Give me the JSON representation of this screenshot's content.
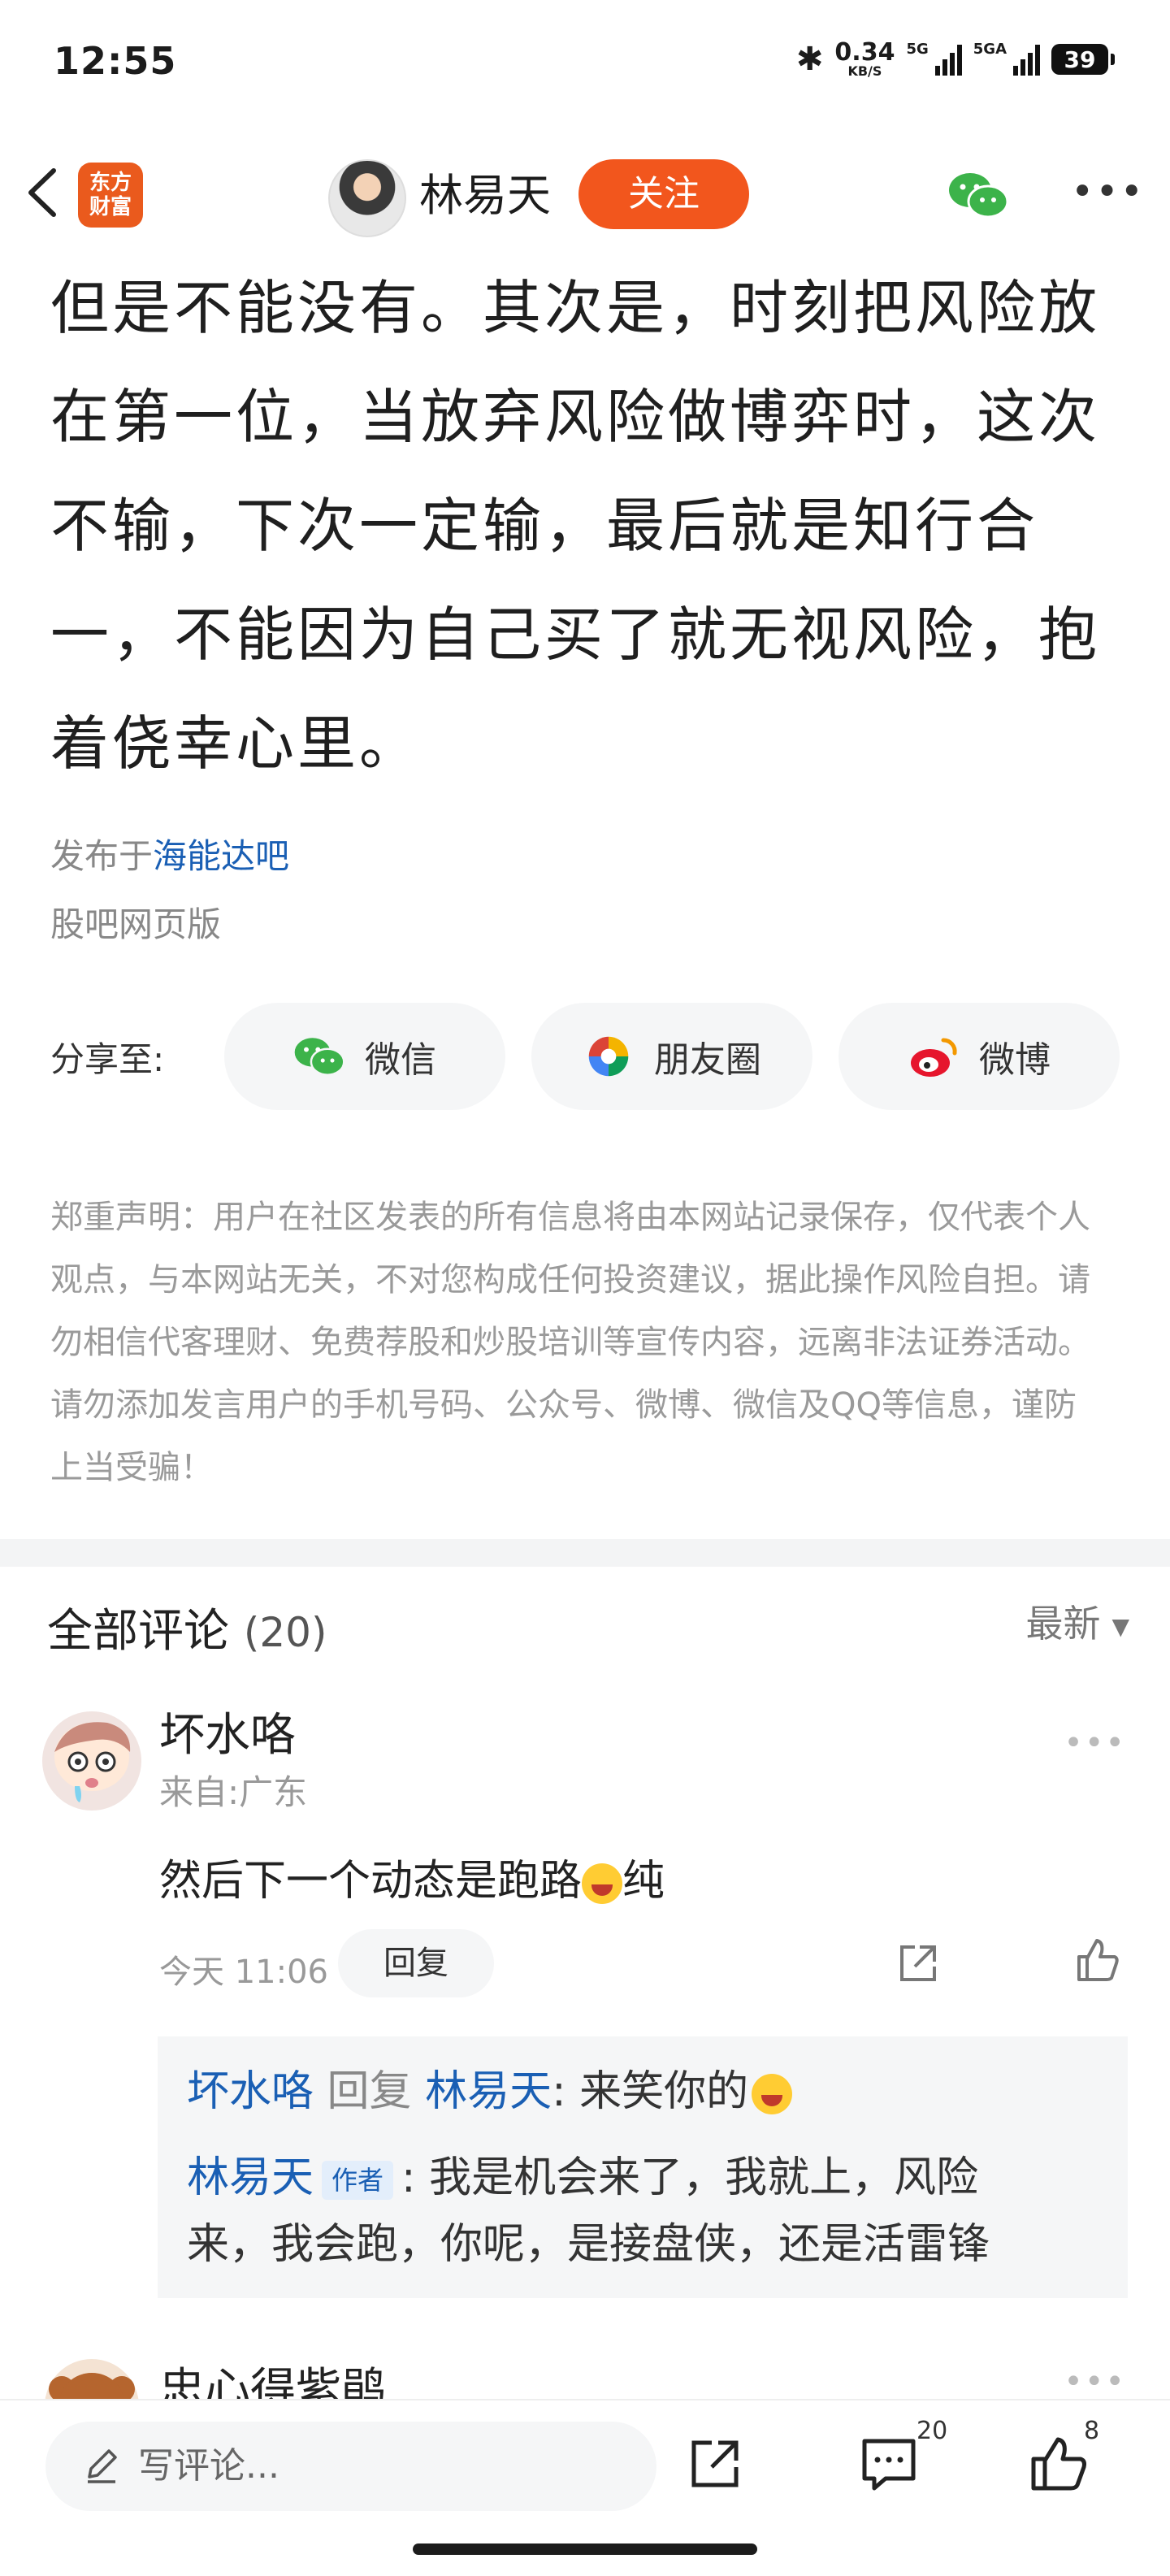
{
  "status_bar": {
    "time": "12:55",
    "speed_value": "0.34",
    "speed_unit": "KB/S",
    "net1": "5G",
    "net2": "5GA",
    "battery": "39"
  },
  "nav": {
    "logo_line1": "东方",
    "logo_line2": "财富",
    "author": "林易天",
    "follow": "关注"
  },
  "article": {
    "lines": [
      "但是不能没有。其次是，时刻把风险放",
      "在第一位，当放弃风险做博弈时，这次",
      "不输，下次一定输，最后就是知行合",
      "一，不能因为自己买了就无视风险，抱",
      "着侥幸心里。"
    ],
    "published_prefix": "发布于",
    "published_bar": "海能达吧",
    "source": "股吧网页版"
  },
  "share": {
    "label": "分享至:",
    "wechat": "微信",
    "moments": "朋友圈",
    "weibo": "微博"
  },
  "disclaimer": "郑重声明：用户在社区发表的所有信息将由本网站记录保存，仅代表个人观点，与本网站无关，不对您构成任何投资建议，据此操作风险自担。请勿相信代客理财、免费荐股和炒股培训等宣传内容，远离非法证券活动。请勿添加发言用户的手机号码、公众号、微博、微信及QQ等信息，谨防上当受骗！",
  "comments": {
    "title": "全部评论",
    "count": "(20)",
    "sort": "最新",
    "items": [
      {
        "user": "坏水咯",
        "location": "来自:广东",
        "text_before": "然后下一个动态是跑路",
        "text_after": "纯",
        "time": "今天 11:06",
        "reply_label": "回复",
        "replies": {
          "r1_user": "坏水咯",
          "r1_mid": "回复",
          "r1_target": "林易天",
          "r1_text": ": 来笑你的",
          "r2_user": "林易天",
          "r2_tag": "作者",
          "r2_text_l1": ": 我是机会来了，我就上，风险",
          "r2_text_l2": "来，我会跑，你呢，是接盘侠，还是活雷锋"
        }
      },
      {
        "user": "忠心得紫鹃"
      }
    ]
  },
  "bottom_bar": {
    "placeholder": "写评论...",
    "comment_count": "20",
    "like_count": "8"
  }
}
